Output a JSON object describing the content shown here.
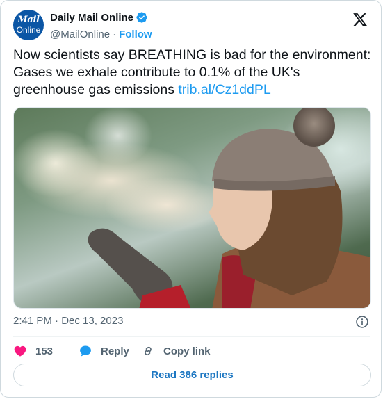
{
  "author": {
    "display_name": "Daily Mail Online",
    "handle": "@MailOnline",
    "separator": "·",
    "follow_label": "Follow",
    "avatar_text_line1": "Mail",
    "avatar_text_line2": "Online",
    "verified": true
  },
  "tweet": {
    "text": "Now scientists say BREATHING is bad for the environment: Gases we exhale contribute to 0.1% of the UK's greenhouse gas emissions ",
    "link": "trib.al/Cz1ddPL",
    "timestamp": "2:41 PM · Dec 13, 2023"
  },
  "actions": {
    "like_count": "153",
    "reply_label": "Reply",
    "copy_link_label": "Copy link"
  },
  "read_replies_label": "Read 386 replies",
  "icons": {
    "verified": "verified-badge-icon",
    "platform": "x-logo-icon",
    "info": "info-icon",
    "like": "heart-icon",
    "reply": "speech-bubble-icon",
    "copy": "link-icon"
  },
  "colors": {
    "accent": "#1d9bf0",
    "like": "#f91880",
    "text": "#0f1419",
    "secondary": "#536471",
    "avatar_bg": "#0b56a5"
  }
}
